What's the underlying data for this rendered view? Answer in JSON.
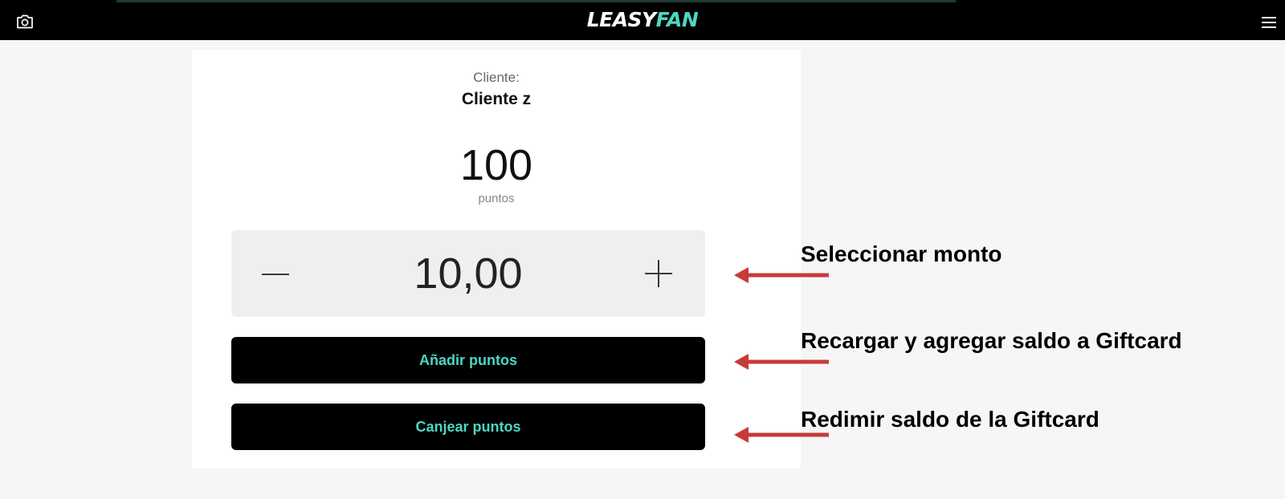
{
  "header": {
    "logo_part1": "LEASY",
    "logo_part2": "FAN",
    "left_icon": "camera-icon",
    "right_icon": "hamburger-menu-icon"
  },
  "card": {
    "client_label": "Cliente:",
    "client_name": "Cliente z",
    "points_value": "100",
    "points_unit": "puntos",
    "stepper": {
      "value": "10,00",
      "minus_icon": "minus-icon",
      "plus_icon": "plus-icon"
    },
    "buttons": {
      "add_label": "Añadir puntos",
      "redeem_label": "Canjear puntos"
    }
  },
  "annotations": [
    "Seleccionar monto",
    "Recargar y agregar saldo a Giftcard",
    "Redimir saldo de la Giftcard"
  ],
  "colors": {
    "accent": "#4dd6c4",
    "arrow": "#c83a3a",
    "topbar": "#000000",
    "page_background": "#f6f6f6"
  }
}
